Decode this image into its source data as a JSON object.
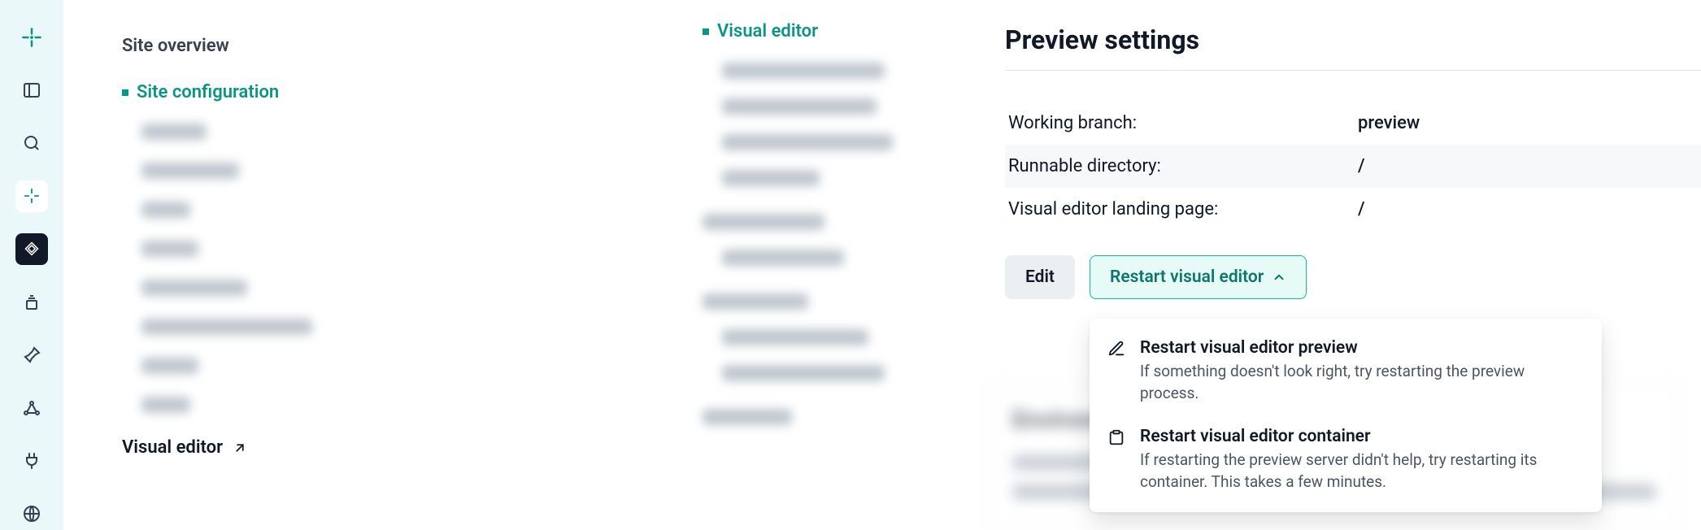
{
  "nav": {
    "site_overview": "Site overview",
    "site_configuration": "Site configuration",
    "visual_editor": "Visual editor"
  },
  "nav2": {
    "visual_editor": "Visual editor"
  },
  "settings": {
    "title": "Preview settings",
    "rows": [
      {
        "k": "Working branch:",
        "v": "preview"
      },
      {
        "k": "Runnable directory:",
        "v": "/"
      },
      {
        "k": "Visual editor landing page:",
        "v": "/"
      }
    ],
    "edit": "Edit",
    "restart": "Restart visual editor"
  },
  "menu": {
    "items": [
      {
        "title": "Restart visual editor preview",
        "desc": "If something doesn't look right, try restarting the preview process."
      },
      {
        "title": "Restart visual editor container",
        "desc": "If restarting the preview server didn't help, try restarting its container. This takes a few minutes."
      }
    ]
  }
}
